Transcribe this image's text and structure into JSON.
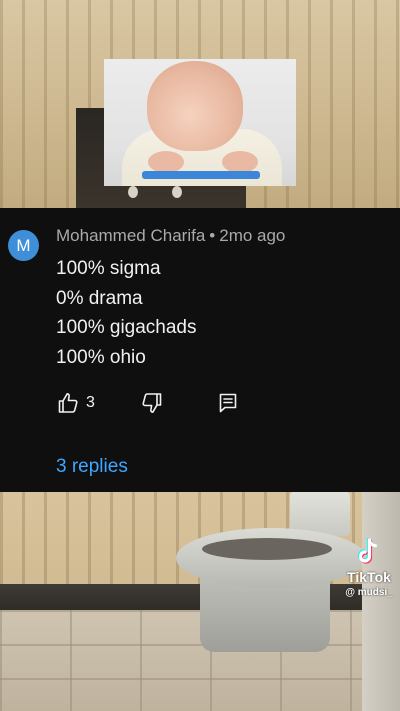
{
  "comment": {
    "avatar_letter": "M",
    "avatar_color": "#3e8fd8",
    "author": "Mohammed Charifa",
    "separator": "•",
    "time": "2mo ago",
    "lines": [
      "100% sigma",
      "0% drama",
      "100% gigachads",
      "100% ohio"
    ],
    "like_count": "3",
    "replies_label": "3 replies",
    "icons": {
      "like": "thumbs-up-icon",
      "dislike": "thumbs-down-icon",
      "reply": "reply-icon"
    }
  },
  "watermark": {
    "brand": "TikTok",
    "handle": "@ mudsi_"
  },
  "colors": {
    "card_background": "#0f0f0f",
    "replies_link": "#3ea6ff"
  }
}
